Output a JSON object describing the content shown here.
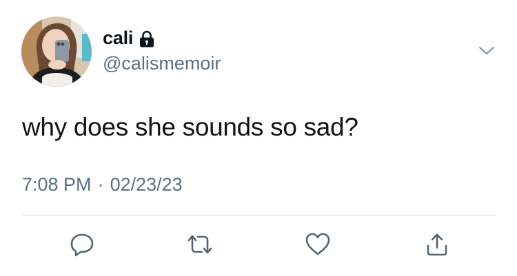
{
  "user": {
    "display_name": "cali",
    "handle": "@calismemoir",
    "protected_icon": "lock-icon"
  },
  "tweet": {
    "text": "why does she sounds so sad?",
    "time": "7:08 PM",
    "separator": "·",
    "date": "02/23/23"
  },
  "menu_icon": "chevron-down-icon",
  "actions": {
    "reply_icon": "reply-icon",
    "retweet_icon": "retweet-icon",
    "like_icon": "heart-icon",
    "share_icon": "share-icon"
  },
  "colors": {
    "text_primary": "#0f1419",
    "text_secondary": "#5b7083",
    "divider": "#cfd9de"
  }
}
